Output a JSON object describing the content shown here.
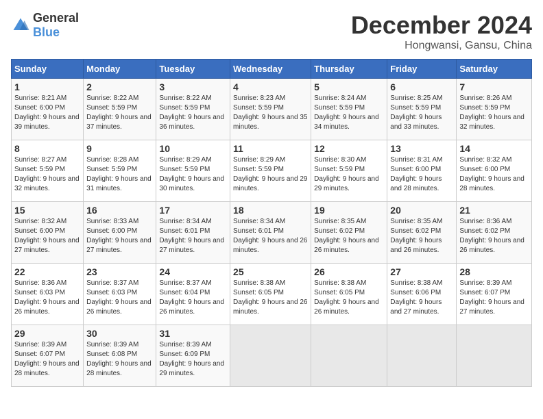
{
  "logo": {
    "text_general": "General",
    "text_blue": "Blue"
  },
  "title": "December 2024",
  "subtitle": "Hongwansi, Gansu, China",
  "days_of_week": [
    "Sunday",
    "Monday",
    "Tuesday",
    "Wednesday",
    "Thursday",
    "Friday",
    "Saturday"
  ],
  "weeks": [
    [
      {
        "day": 1,
        "sunrise": "8:21 AM",
        "sunset": "6:00 PM",
        "daylight": "9 hours and 39 minutes."
      },
      {
        "day": 2,
        "sunrise": "8:22 AM",
        "sunset": "5:59 PM",
        "daylight": "9 hours and 37 minutes."
      },
      {
        "day": 3,
        "sunrise": "8:22 AM",
        "sunset": "5:59 PM",
        "daylight": "9 hours and 36 minutes."
      },
      {
        "day": 4,
        "sunrise": "8:23 AM",
        "sunset": "5:59 PM",
        "daylight": "9 hours and 35 minutes."
      },
      {
        "day": 5,
        "sunrise": "8:24 AM",
        "sunset": "5:59 PM",
        "daylight": "9 hours and 34 minutes."
      },
      {
        "day": 6,
        "sunrise": "8:25 AM",
        "sunset": "5:59 PM",
        "daylight": "9 hours and 33 minutes."
      },
      {
        "day": 7,
        "sunrise": "8:26 AM",
        "sunset": "5:59 PM",
        "daylight": "9 hours and 32 minutes."
      }
    ],
    [
      {
        "day": 8,
        "sunrise": "8:27 AM",
        "sunset": "5:59 PM",
        "daylight": "9 hours and 32 minutes."
      },
      {
        "day": 9,
        "sunrise": "8:28 AM",
        "sunset": "5:59 PM",
        "daylight": "9 hours and 31 minutes."
      },
      {
        "day": 10,
        "sunrise": "8:29 AM",
        "sunset": "5:59 PM",
        "daylight": "9 hours and 30 minutes."
      },
      {
        "day": 11,
        "sunrise": "8:29 AM",
        "sunset": "5:59 PM",
        "daylight": "9 hours and 29 minutes."
      },
      {
        "day": 12,
        "sunrise": "8:30 AM",
        "sunset": "5:59 PM",
        "daylight": "9 hours and 29 minutes."
      },
      {
        "day": 13,
        "sunrise": "8:31 AM",
        "sunset": "6:00 PM",
        "daylight": "9 hours and 28 minutes."
      },
      {
        "day": 14,
        "sunrise": "8:32 AM",
        "sunset": "6:00 PM",
        "daylight": "9 hours and 28 minutes."
      }
    ],
    [
      {
        "day": 15,
        "sunrise": "8:32 AM",
        "sunset": "6:00 PM",
        "daylight": "9 hours and 27 minutes."
      },
      {
        "day": 16,
        "sunrise": "8:33 AM",
        "sunset": "6:00 PM",
        "daylight": "9 hours and 27 minutes."
      },
      {
        "day": 17,
        "sunrise": "8:34 AM",
        "sunset": "6:01 PM",
        "daylight": "9 hours and 27 minutes."
      },
      {
        "day": 18,
        "sunrise": "8:34 AM",
        "sunset": "6:01 PM",
        "daylight": "9 hours and 26 minutes."
      },
      {
        "day": 19,
        "sunrise": "8:35 AM",
        "sunset": "6:02 PM",
        "daylight": "9 hours and 26 minutes."
      },
      {
        "day": 20,
        "sunrise": "8:35 AM",
        "sunset": "6:02 PM",
        "daylight": "9 hours and 26 minutes."
      },
      {
        "day": 21,
        "sunrise": "8:36 AM",
        "sunset": "6:02 PM",
        "daylight": "9 hours and 26 minutes."
      }
    ],
    [
      {
        "day": 22,
        "sunrise": "8:36 AM",
        "sunset": "6:03 PM",
        "daylight": "9 hours and 26 minutes."
      },
      {
        "day": 23,
        "sunrise": "8:37 AM",
        "sunset": "6:03 PM",
        "daylight": "9 hours and 26 minutes."
      },
      {
        "day": 24,
        "sunrise": "8:37 AM",
        "sunset": "6:04 PM",
        "daylight": "9 hours and 26 minutes."
      },
      {
        "day": 25,
        "sunrise": "8:38 AM",
        "sunset": "6:05 PM",
        "daylight": "9 hours and 26 minutes."
      },
      {
        "day": 26,
        "sunrise": "8:38 AM",
        "sunset": "6:05 PM",
        "daylight": "9 hours and 26 minutes."
      },
      {
        "day": 27,
        "sunrise": "8:38 AM",
        "sunset": "6:06 PM",
        "daylight": "9 hours and 27 minutes."
      },
      {
        "day": 28,
        "sunrise": "8:39 AM",
        "sunset": "6:07 PM",
        "daylight": "9 hours and 27 minutes."
      }
    ],
    [
      {
        "day": 29,
        "sunrise": "8:39 AM",
        "sunset": "6:07 PM",
        "daylight": "9 hours and 28 minutes."
      },
      {
        "day": 30,
        "sunrise": "8:39 AM",
        "sunset": "6:08 PM",
        "daylight": "9 hours and 28 minutes."
      },
      {
        "day": 31,
        "sunrise": "8:39 AM",
        "sunset": "6:09 PM",
        "daylight": "9 hours and 29 minutes."
      },
      null,
      null,
      null,
      null
    ]
  ]
}
